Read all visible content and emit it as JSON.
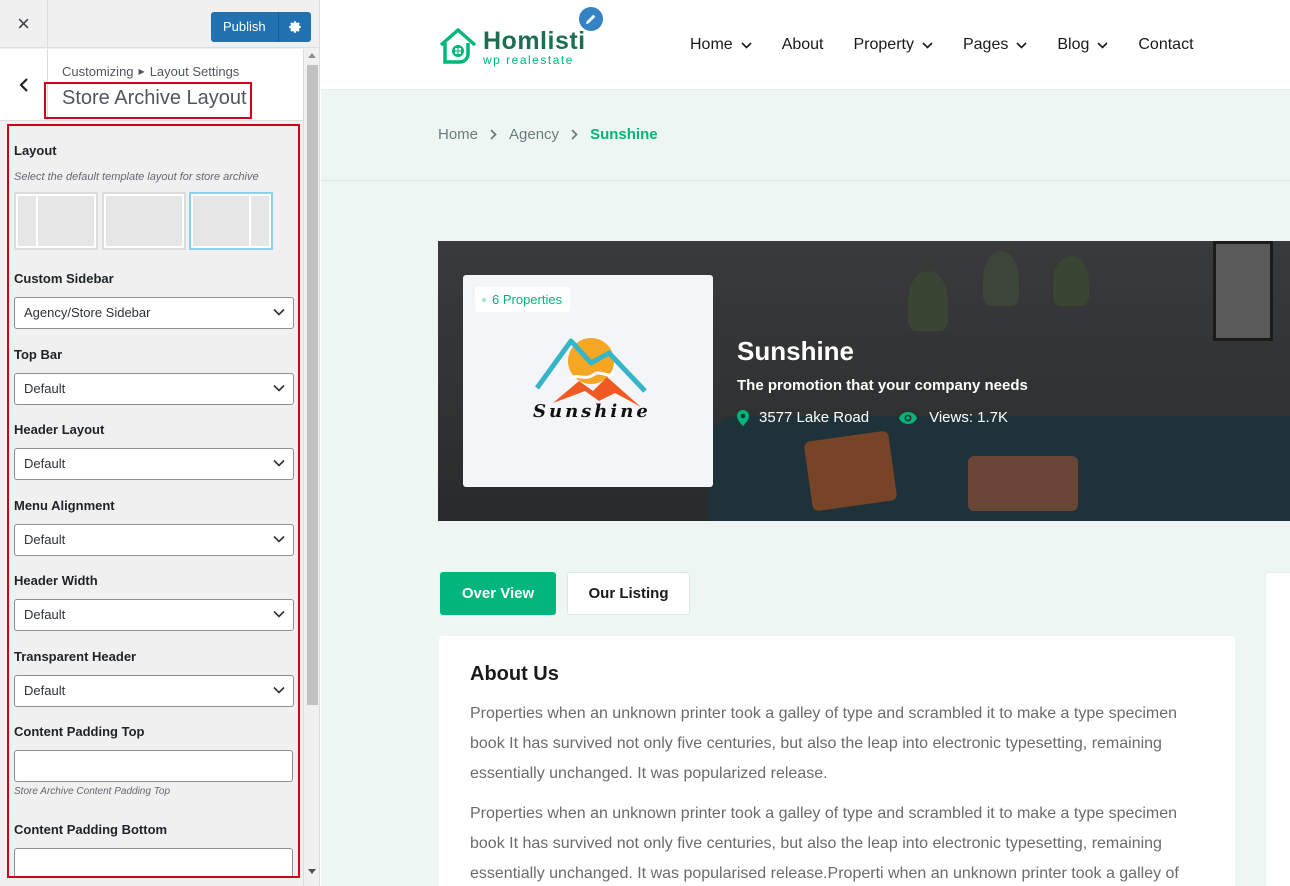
{
  "customizer": {
    "close_label": "×",
    "publish_label": "Publish",
    "breadcrumb": {
      "root": "Customizing",
      "parent": "Layout Settings"
    },
    "section_title": "Store Archive Layout",
    "layout": {
      "label": "Layout",
      "description": "Select the default template layout for store archive",
      "options": [
        "left-sidebar",
        "full-width",
        "right-sidebar"
      ],
      "selected": "right-sidebar"
    },
    "custom_sidebar": {
      "label": "Custom Sidebar",
      "value": "Agency/Store Sidebar"
    },
    "top_bar": {
      "label": "Top Bar",
      "value": "Default"
    },
    "header_layout": {
      "label": "Header Layout",
      "value": "Default"
    },
    "menu_alignment": {
      "label": "Menu Alignment",
      "value": "Default"
    },
    "header_width": {
      "label": "Header Width",
      "value": "Default"
    },
    "transparent_header": {
      "label": "Transparent Header",
      "value": "Default"
    },
    "content_padding_top": {
      "label": "Content Padding Top",
      "value": "",
      "description": "Store Archive Content Padding Top"
    },
    "content_padding_bottom": {
      "label": "Content Padding Bottom",
      "value": ""
    }
  },
  "site": {
    "logo": {
      "name": "Homlisti",
      "tagline": "wp realestate"
    },
    "nav": [
      "Home",
      "About",
      "Property",
      "Pages",
      "Blog",
      "Contact"
    ],
    "nav_has_dropdown": [
      true,
      false,
      true,
      true,
      true,
      false
    ],
    "breadcrumb": [
      "Home",
      "Agency",
      "Sunshine"
    ],
    "agency": {
      "properties_badge": "6 Properties",
      "logo_text": "Sunshine",
      "name": "Sunshine",
      "tagline": "The promotion that your company needs",
      "address": "3577 Lake Road",
      "views": "Views: 1.7K"
    },
    "tabs": [
      "Over View",
      "Our Listing"
    ],
    "about": {
      "title": "About Us",
      "paragraphs": [
        "Properties when an unknown printer took a galley of type and scrambled it to make a type specimen book It has survived not only five centuries, but also the leap into electronic typesetting, remaining essentially unchanged. It was popularized release.",
        "Properties when an unknown printer took a galley of type and scrambled it to make a type specimen book It has survived not only five centuries, but also the leap into electronic typesetting, remaining essentially unchanged. It was popularised release.Properti when an unknown printer took a galley of"
      ]
    }
  },
  "colors": {
    "wp_blue": "#2271b1",
    "brand_green": "#00b67a",
    "brand_dark_green": "#1c6f53",
    "highlight_red": "#d0021b"
  },
  "icons": [
    "close-icon",
    "gear-icon",
    "back-arrow-icon",
    "chevron-down-icon",
    "pencil-icon",
    "map-pin-icon",
    "eye-icon",
    "house-logo-icon"
  ]
}
